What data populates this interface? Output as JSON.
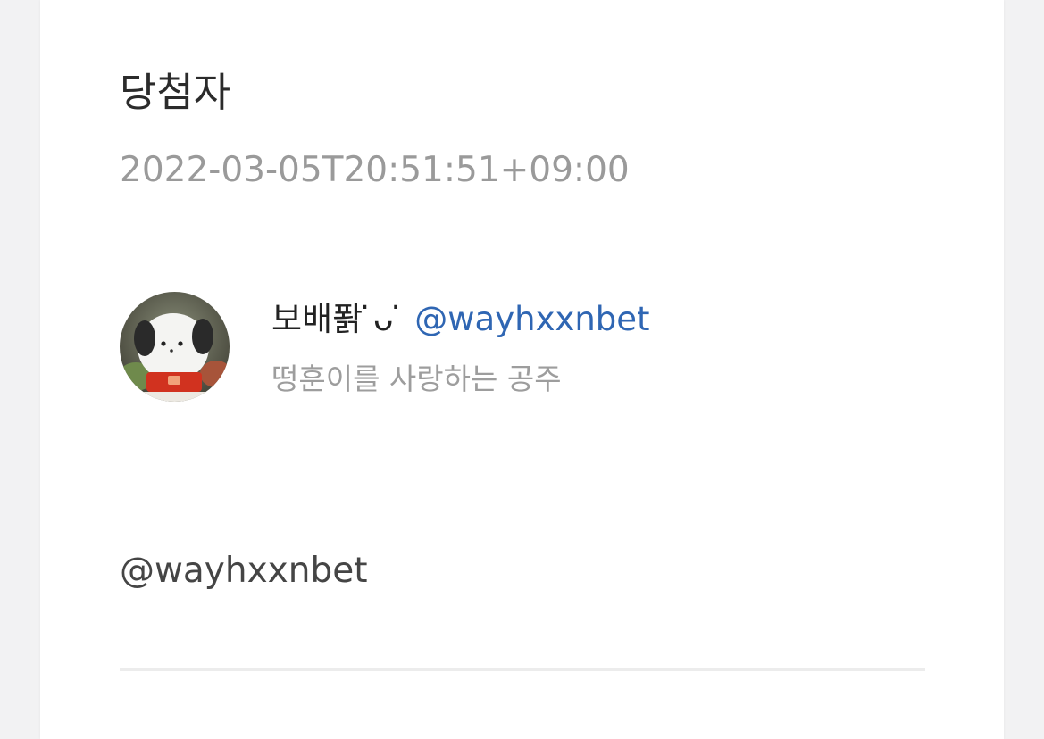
{
  "card": {
    "title": "당첨자",
    "timestamp": "2022-03-05T20:51:51+09:00",
    "profile": {
      "display_name": "보배퐑 ̇ᴗ ̇",
      "handle": "@wayhxxnbet",
      "bio": "떵훈이를 사랑하는 공주"
    },
    "mention": "@wayhxxnbet"
  },
  "colors": {
    "handle_link": "#2f66b3",
    "muted_text": "#9a9a9a",
    "page_background": "#f2f2f3"
  }
}
